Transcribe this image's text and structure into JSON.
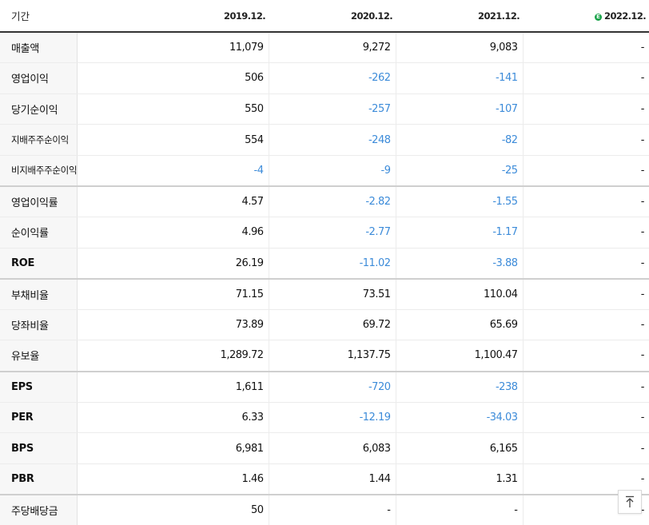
{
  "header": {
    "label": "기간",
    "periods": [
      "2019.12.",
      "2020.12.",
      "2021.12.",
      "2022.12."
    ],
    "estimate_badge": "E"
  },
  "rows": [
    {
      "label": "매출액",
      "values": [
        "11,079",
        "9,272",
        "9,083",
        "-"
      ],
      "negative": [
        false,
        false,
        false,
        false
      ]
    },
    {
      "label": "영업이익",
      "values": [
        "506",
        "-262",
        "-141",
        "-"
      ],
      "negative": [
        false,
        true,
        true,
        false
      ]
    },
    {
      "label": "당기순이익",
      "values": [
        "550",
        "-257",
        "-107",
        "-"
      ],
      "negative": [
        false,
        true,
        true,
        false
      ]
    },
    {
      "label": "지배주주순이익",
      "values": [
        "554",
        "-248",
        "-82",
        "-"
      ],
      "negative": [
        false,
        true,
        true,
        false
      ]
    },
    {
      "label": "비지배주주순이익",
      "values": [
        "-4",
        "-9",
        "-25",
        "-"
      ],
      "negative": [
        true,
        true,
        true,
        false
      ]
    },
    {
      "label": "영업이익률",
      "values": [
        "4.57",
        "-2.82",
        "-1.55",
        "-"
      ],
      "negative": [
        false,
        true,
        true,
        false
      ]
    },
    {
      "label": "순이익률",
      "values": [
        "4.96",
        "-2.77",
        "-1.17",
        "-"
      ],
      "negative": [
        false,
        true,
        true,
        false
      ]
    },
    {
      "label": "ROE",
      "values": [
        "26.19",
        "-11.02",
        "-3.88",
        "-"
      ],
      "negative": [
        false,
        true,
        true,
        false
      ]
    },
    {
      "label": "부채비율",
      "values": [
        "71.15",
        "73.51",
        "110.04",
        "-"
      ],
      "negative": [
        false,
        false,
        false,
        false
      ]
    },
    {
      "label": "당좌비율",
      "values": [
        "73.89",
        "69.72",
        "65.69",
        "-"
      ],
      "negative": [
        false,
        false,
        false,
        false
      ]
    },
    {
      "label": "유보율",
      "values": [
        "1,289.72",
        "1,137.75",
        "1,100.47",
        "-"
      ],
      "negative": [
        false,
        false,
        false,
        false
      ]
    },
    {
      "label": "EPS",
      "values": [
        "1,611",
        "-720",
        "-238",
        "-"
      ],
      "negative": [
        false,
        true,
        true,
        false
      ]
    },
    {
      "label": "PER",
      "values": [
        "6.33",
        "-12.19",
        "-34.03",
        "-"
      ],
      "negative": [
        false,
        true,
        true,
        false
      ]
    },
    {
      "label": "BPS",
      "values": [
        "6,981",
        "6,083",
        "6,165",
        "-"
      ],
      "negative": [
        false,
        false,
        false,
        false
      ]
    },
    {
      "label": "PBR",
      "values": [
        "1.46",
        "1.44",
        "1.31",
        "-"
      ],
      "negative": [
        false,
        false,
        false,
        false
      ]
    },
    {
      "label": "주당배당금",
      "values": [
        "50",
        "-",
        "-",
        "-"
      ],
      "negative": [
        false,
        false,
        false,
        false
      ]
    }
  ],
  "colors": {
    "negative": "#3c8bd9",
    "estimate_badge": "#1aa34a"
  },
  "scroll_top_button": {
    "icon": "arrow-up-icon"
  }
}
